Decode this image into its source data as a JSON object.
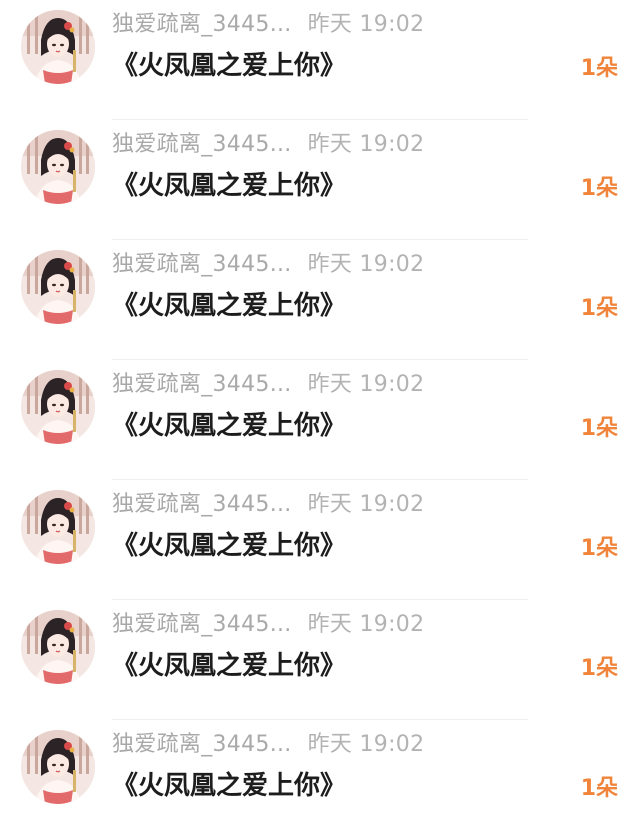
{
  "messages": [
    {
      "user": "独爱疏离_3445...",
      "time": "昨天 19:02",
      "title": "《火凤凰之爱上你》",
      "count": "1朵",
      "avatar_icon": "avatar-girl-icon"
    },
    {
      "user": "独爱疏离_3445...",
      "time": "昨天 19:02",
      "title": "《火凤凰之爱上你》",
      "count": "1朵",
      "avatar_icon": "avatar-girl-icon"
    },
    {
      "user": "独爱疏离_3445...",
      "time": "昨天 19:02",
      "title": "《火凤凰之爱上你》",
      "count": "1朵",
      "avatar_icon": "avatar-girl-icon"
    },
    {
      "user": "独爱疏离_3445...",
      "time": "昨天 19:02",
      "title": "《火凤凰之爱上你》",
      "count": "1朵",
      "avatar_icon": "avatar-girl-icon"
    },
    {
      "user": "独爱疏离_3445...",
      "time": "昨天 19:02",
      "title": "《火凤凰之爱上你》",
      "count": "1朵",
      "avatar_icon": "avatar-girl-icon"
    },
    {
      "user": "独爱疏离_3445...",
      "time": "昨天 19:02",
      "title": "《火凤凰之爱上你》",
      "count": "1朵",
      "avatar_icon": "avatar-girl-icon"
    },
    {
      "user": "独爱疏离_3445...",
      "time": "昨天 19:02",
      "title": "《火凤凰之爱上你》",
      "count": "1朵",
      "avatar_icon": "avatar-girl-icon"
    }
  ],
  "colors": {
    "count_accent": "#f0843a",
    "meta_text": "#a9a9a9",
    "title_text": "#1d1d1d"
  }
}
